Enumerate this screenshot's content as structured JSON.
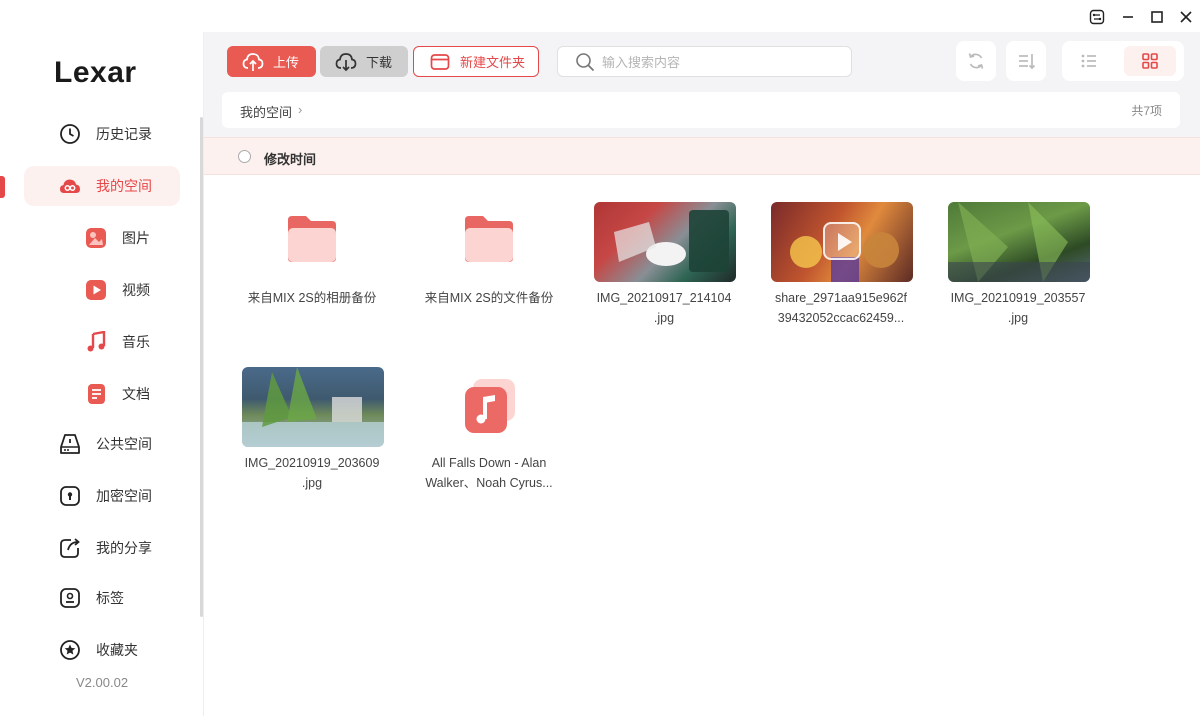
{
  "app": {
    "logo": "Lexar",
    "version": "V2.00.02"
  },
  "colors": {
    "accent": "#e54848",
    "accent_soft": "#fdf1ef",
    "sidebar_bg": "#ffffff",
    "toolbar_bg": "#f4f4f6"
  },
  "sidebar": {
    "items": [
      {
        "label": "历史记录",
        "icon": "clock-icon"
      },
      {
        "label": "我的空间",
        "icon": "cloud-icon",
        "active": true
      },
      {
        "label": "图片",
        "icon": "image-icon"
      },
      {
        "label": "视频",
        "icon": "video-icon"
      },
      {
        "label": "音乐",
        "icon": "music-icon"
      },
      {
        "label": "文档",
        "icon": "document-icon"
      },
      {
        "label": "公共空间",
        "icon": "drive-icon"
      },
      {
        "label": "加密空间",
        "icon": "lock-icon"
      },
      {
        "label": "我的分享",
        "icon": "share-icon"
      },
      {
        "label": "标签",
        "icon": "tag-icon"
      },
      {
        "label": "收藏夹",
        "icon": "star-icon"
      }
    ]
  },
  "toolbar": {
    "upload_label": "上传",
    "download_label": "下载",
    "new_folder_label": "新建文件夹",
    "search_placeholder": "输入搜索内容"
  },
  "breadcrumb": {
    "path": "我的空间",
    "count": "共7项"
  },
  "sort": {
    "label": "修改时间"
  },
  "files": [
    {
      "name": "来自MIX 2S的相册备份",
      "kind": "folder"
    },
    {
      "name": "来自MIX 2S的文件备份",
      "kind": "folder"
    },
    {
      "name": "IMG_20210917_214104 .jpg",
      "line1": "IMG_20210917_214104",
      "line2": ".jpg",
      "kind": "image"
    },
    {
      "name": "share_2971aa915e962f 39432052ccac62459...",
      "line1": "share_2971aa915e962f",
      "line2": "39432052ccac62459...",
      "kind": "video"
    },
    {
      "name": "IMG_20210919_203557 .jpg",
      "line1": "IMG_20210919_203557",
      "line2": ".jpg",
      "kind": "image"
    },
    {
      "name": "IMG_20210919_203609 .jpg",
      "line1": "IMG_20210919_203609",
      "line2": ".jpg",
      "kind": "image"
    },
    {
      "name": "All Falls Down - Alan Walker、Noah Cyrus...",
      "line1": "All Falls Down - Alan",
      "line2": "Walker、Noah Cyrus...",
      "kind": "music"
    }
  ]
}
